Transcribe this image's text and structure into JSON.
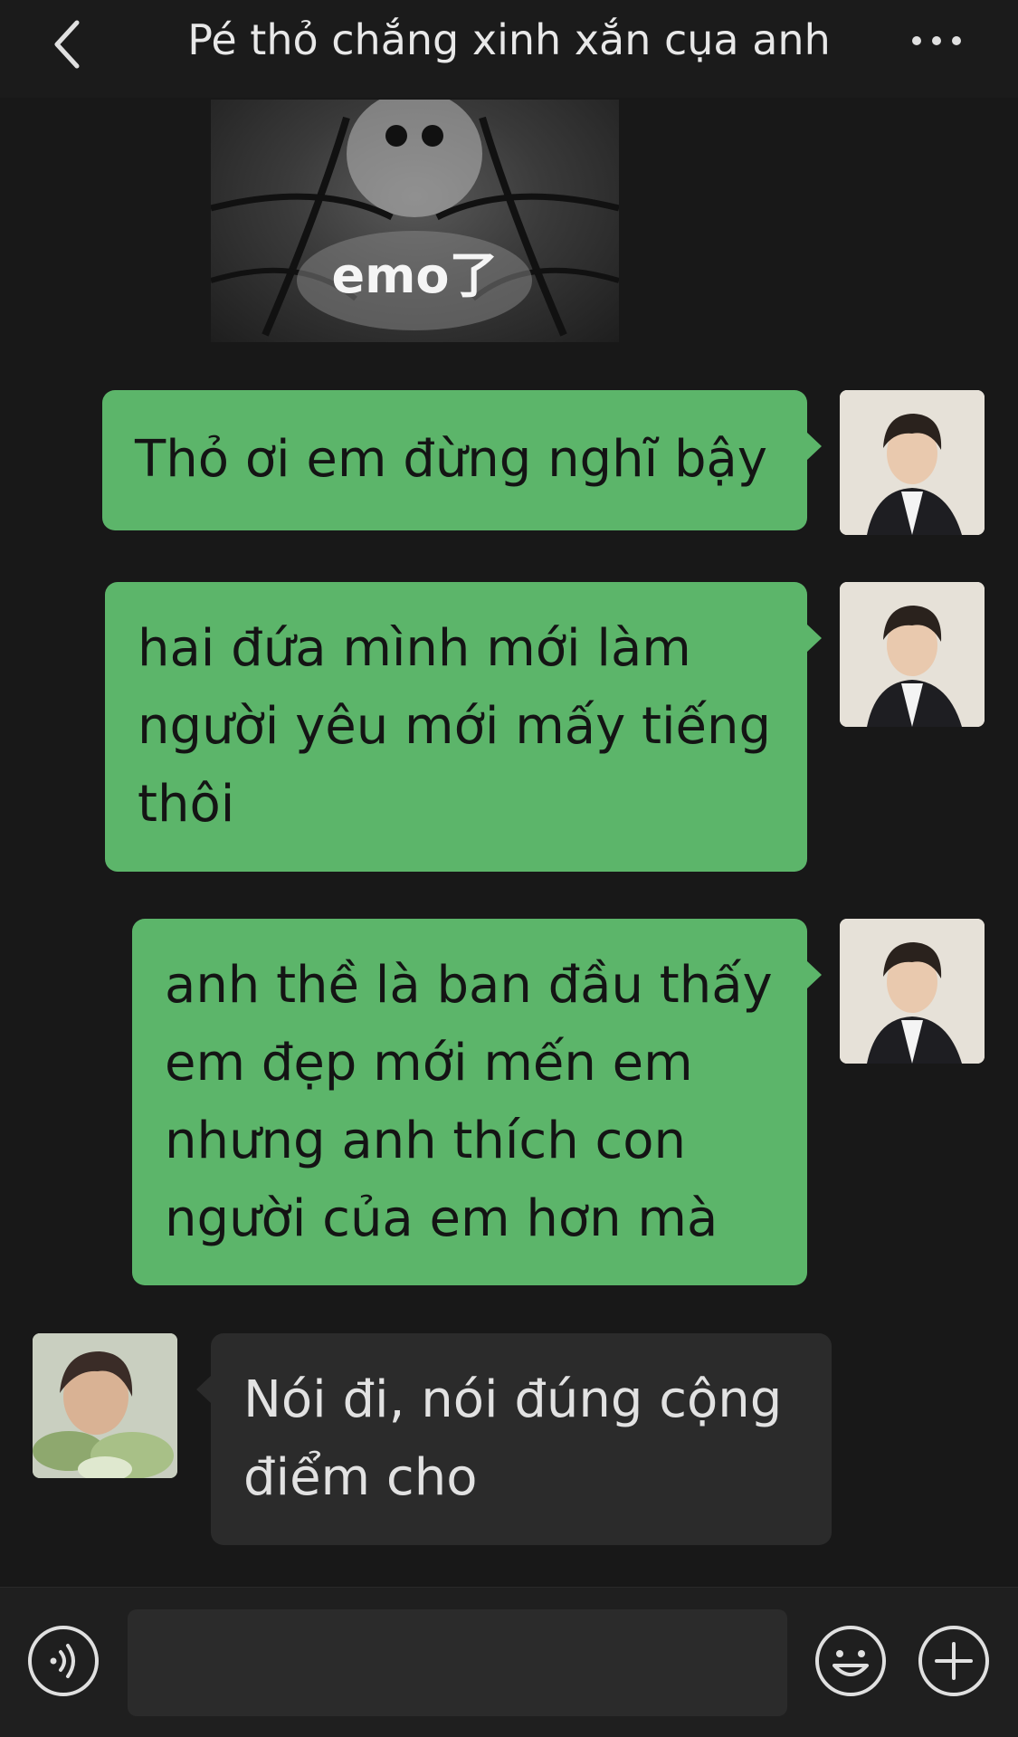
{
  "header": {
    "title": "Pé thỏ chắng xinh xắn cụa anh",
    "back_icon": "chevron-left-icon",
    "more_icon": "more-horizontal-icon"
  },
  "sticker": {
    "caption": "emo了"
  },
  "messages": [
    {
      "direction": "outgoing",
      "lines": [
        "Thỏ ơi em đừng nghĩ bậy"
      ]
    },
    {
      "direction": "outgoing",
      "lines": [
        "hai đứa mình mới làm",
        "người yêu mới mấy tiếng",
        "thôi"
      ]
    },
    {
      "direction": "outgoing",
      "lines": [
        "anh thề là ban đầu thấy",
        "em đẹp mới mến em",
        "nhưng anh thích con",
        "người của em hơn mà"
      ]
    },
    {
      "direction": "incoming",
      "lines": [
        "Nói đi, nói đúng cộng",
        "điểm cho"
      ]
    }
  ],
  "input_bar": {
    "voice_icon": "voice-icon",
    "emoji_icon": "emoji-icon",
    "plus_icon": "plus-icon",
    "message_value": ""
  },
  "colors": {
    "background": "#181818",
    "outgoing_bubble": "#5cb56a",
    "incoming_bubble": "#2b2b2b",
    "header_text": "#e8e8e8"
  }
}
